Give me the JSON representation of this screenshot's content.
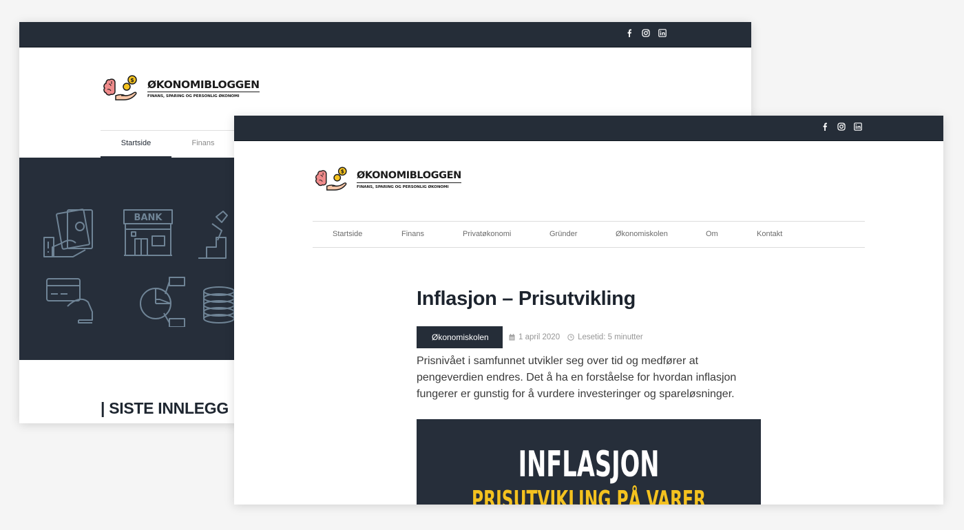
{
  "colors": {
    "dark": "#252d38",
    "accent_yellow": "#f4c21f",
    "bg": "#f5f5f5",
    "icon_stroke": "#6f8496"
  },
  "logo": {
    "title": "ØKONOMIBLOGGEN",
    "subtitle": "FINANS, SPARING OG PERSONLIG ØKONOMI"
  },
  "social_icons": [
    "facebook-icon",
    "instagram-icon",
    "linkedin-icon"
  ],
  "back_window": {
    "nav": [
      {
        "label": "Startside",
        "active": true
      },
      {
        "label": "Finans",
        "active": false
      }
    ],
    "hero_icons": [
      "money-hand-icon",
      "bank-icon",
      "climb-icon",
      "card-payment-icon",
      "pie-chart-icon",
      "coins-icon"
    ],
    "bank_sign": "BANK",
    "section_title": "| SISTE INNLEGG"
  },
  "front_window": {
    "nav": [
      "Startside",
      "Finans",
      "Privatøkonomi",
      "Gründer",
      "Økonomiskolen",
      "Om",
      "Kontakt"
    ],
    "article": {
      "title": "Inflasjon – Prisutvikling",
      "category": "Økonomiskolen",
      "date": "1 april 2020",
      "reading_time": "Lesetid: 5 minutter",
      "intro": "Prisnivået i samfunnet utvikler seg over tid og medfører at pengeverdien endres. Det å ha en forståelse for hvordan inflasjon fungerer er gunstig for å vurdere investeringer og spareløsninger.",
      "feature_title": "INFLASJON",
      "feature_subtitle": "PRISUTVIKLING PÅ VARER"
    }
  }
}
